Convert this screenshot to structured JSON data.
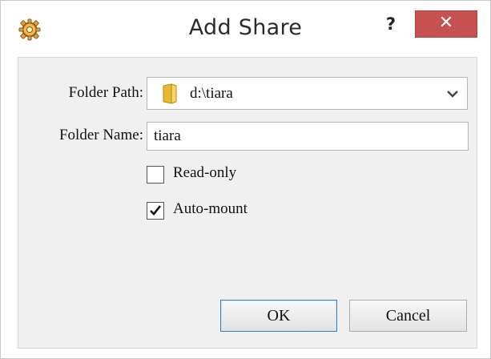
{
  "window": {
    "title": "Add Share",
    "help_label": "?",
    "close_label": "✕",
    "app_icon": "gear-icon",
    "colors": {
      "close_bg": "#c75050",
      "client_bg": "#f0f0f0",
      "default_border": "#3c7fb1"
    }
  },
  "form": {
    "folder_path": {
      "label": "Folder Path:",
      "value": "d:\\tiara",
      "icon": "folder-icon"
    },
    "folder_name": {
      "label": "Folder Name:",
      "value": "tiara"
    },
    "read_only": {
      "label": "Read-only",
      "checked": false
    },
    "auto_mount": {
      "label": "Auto-mount",
      "checked": true
    }
  },
  "buttons": {
    "ok": "OK",
    "cancel": "Cancel"
  }
}
